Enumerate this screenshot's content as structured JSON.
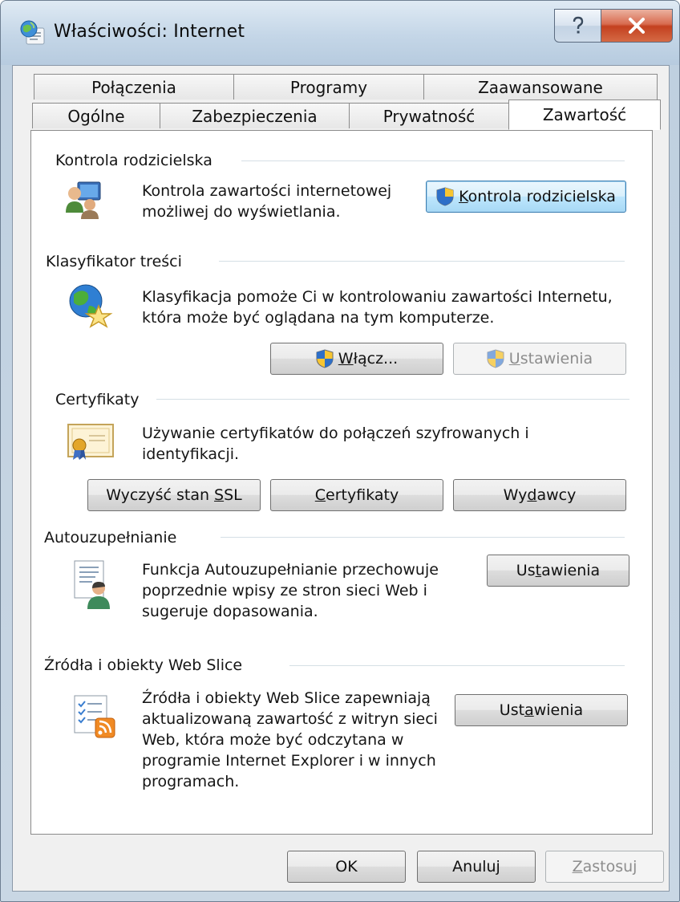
{
  "window": {
    "title": "Właściwości: Internet"
  },
  "tabs_back": [
    "Połączenia",
    "Programy",
    "Zaawansowane"
  ],
  "tabs_front": [
    "Ogólne",
    "Zabezpieczenia",
    "Prywatność",
    "Zawartość"
  ],
  "active_tab": "Zawartość",
  "parental": {
    "label": "Kontrola rodzicielska",
    "desc1": "Kontrola zawartości internetowej",
    "desc2": "możliwej do wyświetlania.",
    "button": {
      "pre": "",
      "u": "K",
      "post": "ontrola rodzicielska"
    }
  },
  "advisor": {
    "label": "Klasyfikator treści",
    "desc1": "Klasyfikacja pomoże Ci w kontrolowaniu zawartości Internetu,",
    "desc2": "która może być oglądana na tym komputerze.",
    "enable_button": {
      "pre": "",
      "u": "W",
      "post": "łącz..."
    },
    "settings_button": {
      "pre": "",
      "u": "U",
      "post": "stawienia"
    }
  },
  "certificates": {
    "label": "Certyfikaty",
    "desc1": "Używanie certyfikatów do połączeń szyfrowanych i",
    "desc2": "identyfikacji.",
    "ssl_button": {
      "pre": "Wyczyść stan ",
      "u": "S",
      "post": "SL"
    },
    "certs_button": {
      "pre": "",
      "u": "C",
      "post": "ertyfikaty"
    },
    "publishers_button": {
      "pre": "Wy",
      "u": "d",
      "post": "awcy"
    }
  },
  "autocomplete": {
    "label": "Autouzupełnianie",
    "desc1": "Funkcja Autouzupełnianie przechowuje",
    "desc2": "poprzednie wpisy ze stron sieci Web i",
    "desc3": "sugeruje dopasowania.",
    "settings_button": {
      "pre": "Us",
      "u": "t",
      "post": "awienia"
    }
  },
  "feeds": {
    "label": "Źródła i obiekty Web Slice",
    "desc1": "Źródła i obiekty Web Slice zapewniają",
    "desc2": "aktualizowaną zawartość z witryn sieci",
    "desc3": "Web, która może być odczytana w",
    "desc4": "programie Internet Explorer i w innych",
    "desc5": "programach.",
    "settings_button": {
      "pre": "Ust",
      "u": "a",
      "post": "wienia"
    }
  },
  "footer": {
    "ok": "OK",
    "cancel": "Anuluj",
    "apply": {
      "pre": "",
      "u": "Z",
      "post": "astosuj"
    }
  },
  "colors": {
    "accent": "#3c7fb1",
    "close": "#c3401f"
  },
  "icons": [
    "ie-globe-icon",
    "help-icon",
    "close-icon",
    "parental-users-icon",
    "globe-star-icon",
    "certificate-icon",
    "autocomplete-user-icon",
    "feeds-rss-icon",
    "uac-shield-icon"
  ]
}
